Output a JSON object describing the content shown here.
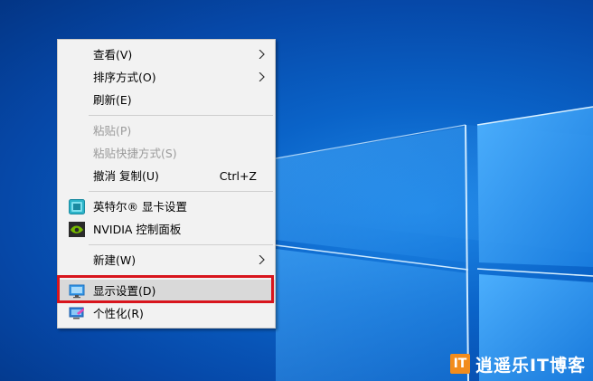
{
  "menu": {
    "items": [
      {
        "label": "查看(V)",
        "submenu": true
      },
      {
        "label": "排序方式(O)",
        "submenu": true
      },
      {
        "label": "刷新(E)"
      },
      {
        "label": "粘贴(P)",
        "disabled": true
      },
      {
        "label": "粘贴快捷方式(S)",
        "disabled": true
      },
      {
        "label": "撤消 复制(U)",
        "shortcut": "Ctrl+Z"
      },
      {
        "label": "英特尔® 显卡设置",
        "icon": "intel-graphics-icon"
      },
      {
        "label": "NVIDIA 控制面板",
        "icon": "nvidia-icon"
      },
      {
        "label": "新建(W)",
        "submenu": true
      },
      {
        "label": "显示设置(D)",
        "icon": "display-icon",
        "highlighted": true
      },
      {
        "label": "个性化(R)",
        "icon": "personalize-icon"
      }
    ]
  },
  "watermark": {
    "logo": "IT",
    "text": "逍遥乐IT博客"
  },
  "colors": {
    "highlight_frame": "#d8151d",
    "menu_bg": "#f2f2f2",
    "wallpaper": "#0a63c8",
    "watermark_logo": "#f28c1c"
  }
}
